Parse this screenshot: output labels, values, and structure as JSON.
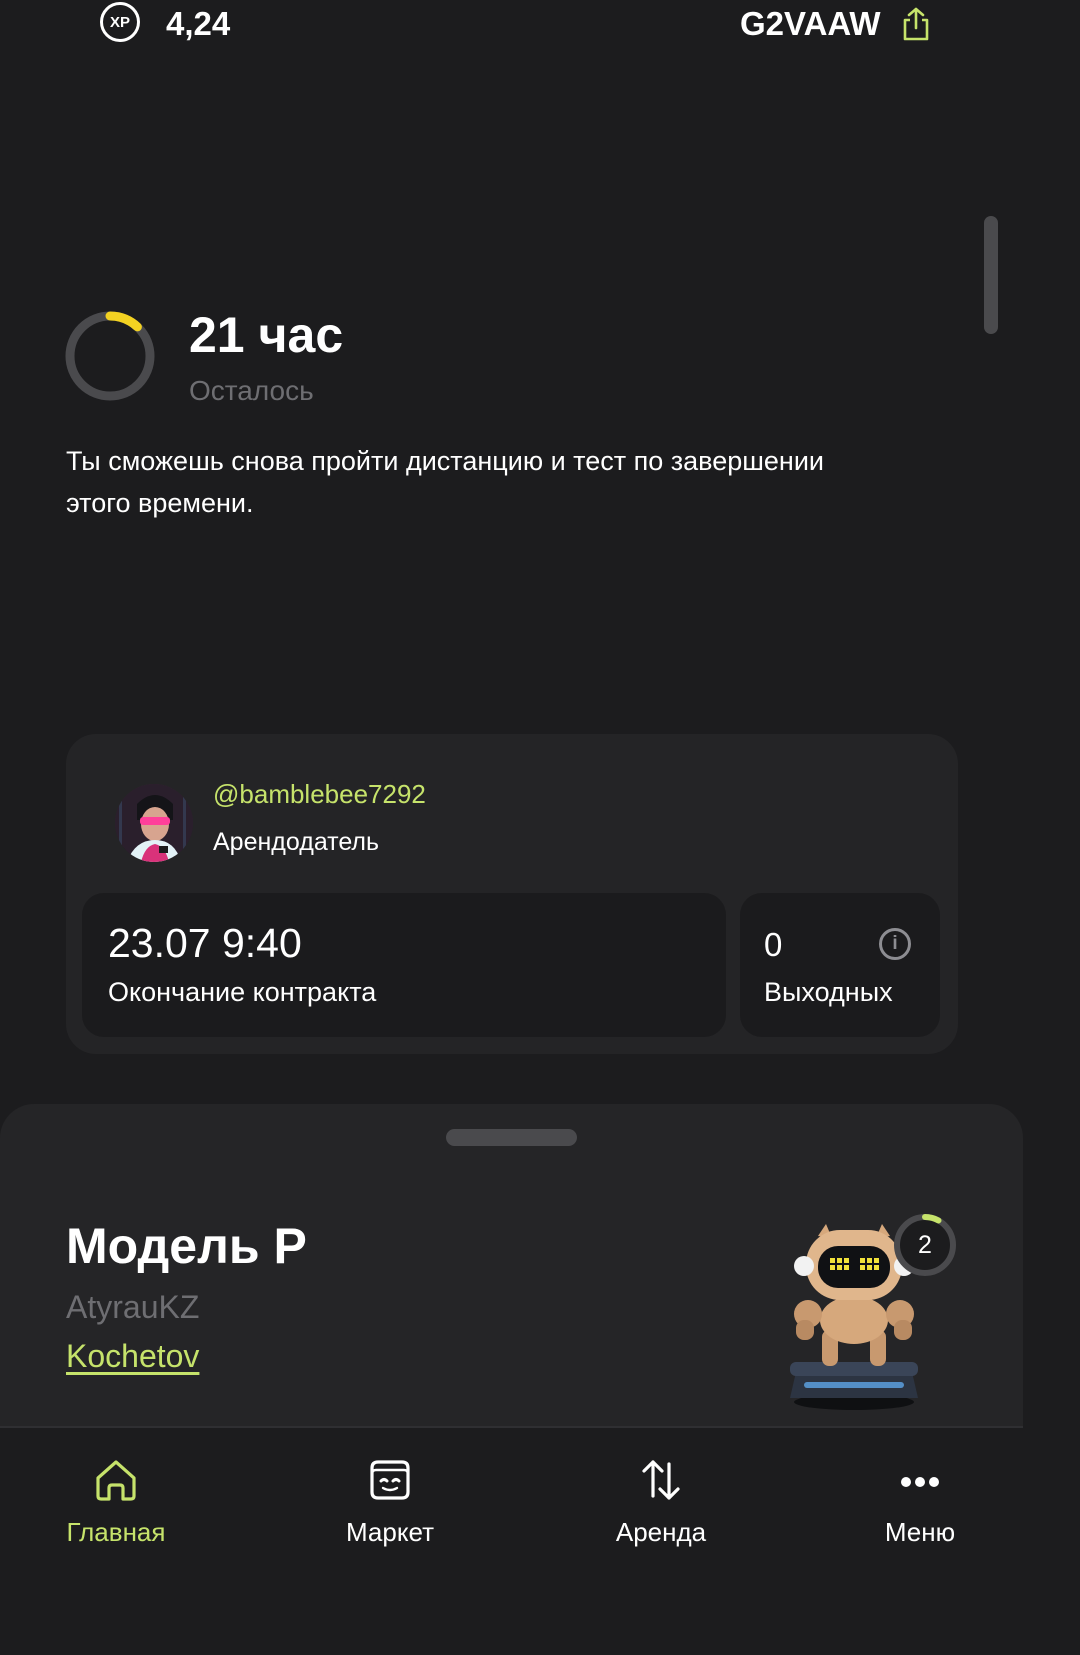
{
  "header": {
    "xp_badge": "XP",
    "xp_value": "4,24",
    "ref_code": "G2VAAW",
    "share_icon": "share-icon"
  },
  "timer": {
    "value": "21 час",
    "caption": "Осталось",
    "note": "Ты сможешь снова пройти дистанцию и тест по завершении этого времени.",
    "progress": 0.12,
    "accent_color": "#f3d222"
  },
  "contract": {
    "owner_handle": "@bamblebee7292",
    "owner_role": "Арендодатель",
    "end_value": "23.07 9:40",
    "end_label": "Окончание контракта",
    "days_off_value": "0",
    "days_off_label": "Выходных",
    "info_icon": "info-icon"
  },
  "model": {
    "title": "Модель P",
    "city": "AtyrauKZ",
    "link": "Kochetov",
    "level": "2",
    "level_progress": 0.08
  },
  "tabs": [
    {
      "label": "Главная",
      "icon": "home-icon",
      "active": true
    },
    {
      "label": "Маркет",
      "icon": "market-icon",
      "active": false
    },
    {
      "label": "Аренда",
      "icon": "arrows-updown-icon",
      "active": false
    },
    {
      "label": "Меню",
      "icon": "more-icon",
      "active": false
    }
  ],
  "colors": {
    "background": "#1c1c1e",
    "card": "#242426",
    "tile": "#1b1b1d",
    "accent": "#c6e36b",
    "muted": "#6e6e72"
  }
}
